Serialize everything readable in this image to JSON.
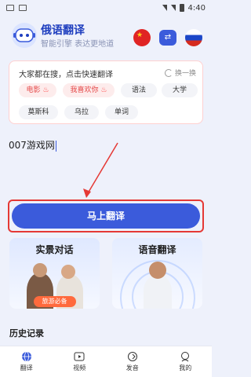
{
  "status_bar": {
    "time": "4:40"
  },
  "header": {
    "brand_title": "俄语翻译",
    "brand_subtitle": "智能引擎 表达更地道",
    "source_flag": "china-flag",
    "target_flag": "russia-flag"
  },
  "hot_search": {
    "title": "大家都在搜，点击快速翻译",
    "refresh_label": "换一换",
    "tags": [
      {
        "label": "电影",
        "hot": true
      },
      {
        "label": "我喜欢你",
        "hot": true
      },
      {
        "label": "语法",
        "hot": false
      },
      {
        "label": "大学",
        "hot": false
      },
      {
        "label": "莫斯科",
        "hot": false
      },
      {
        "label": "乌拉",
        "hot": false
      },
      {
        "label": "单词",
        "hot": false
      }
    ]
  },
  "input": {
    "value": "007游戏网"
  },
  "translate_button": {
    "label": "马上翻译"
  },
  "features": [
    {
      "title": "实景对话",
      "badge": "旅游必备"
    },
    {
      "title": "语音翻译"
    }
  ],
  "history": {
    "title": "历史记录"
  },
  "tabbar": [
    {
      "label": "翻译",
      "icon": "globe-icon",
      "active": true
    },
    {
      "label": "视频",
      "icon": "play-icon",
      "active": false
    },
    {
      "label": "发音",
      "icon": "sound-icon",
      "active": false
    },
    {
      "label": "我的",
      "icon": "user-icon",
      "active": false
    }
  ],
  "colors": {
    "primary": "#3b5bdb",
    "highlight_border": "#e53935",
    "hot_tag": "#e54848"
  }
}
